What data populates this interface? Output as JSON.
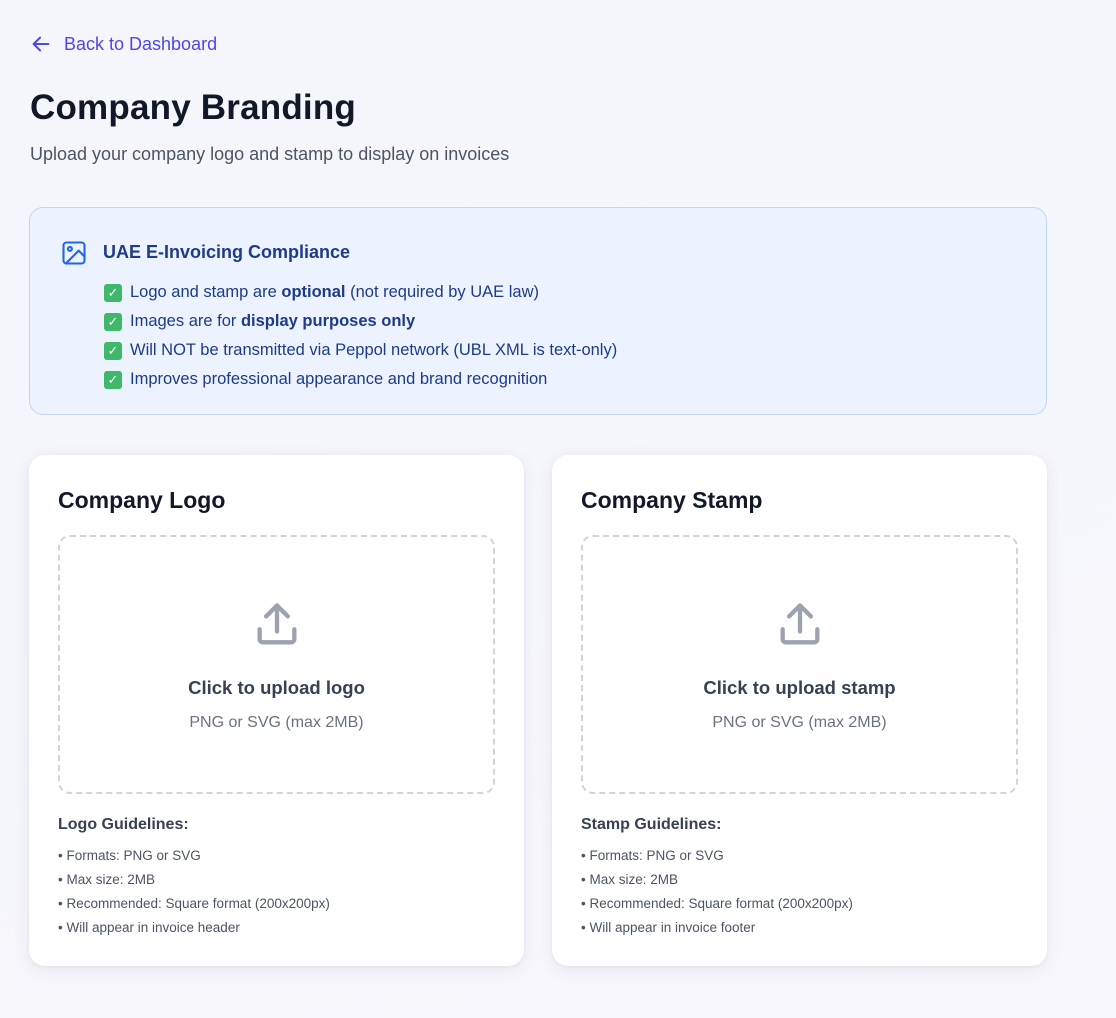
{
  "nav": {
    "back_label": "Back to Dashboard"
  },
  "header": {
    "title": "Company Branding",
    "subtitle": "Upload your company logo and stamp to display on invoices"
  },
  "notice": {
    "title": "UAE E-Invoicing Compliance",
    "items": [
      {
        "pre": "Logo and stamp are ",
        "bold": "optional",
        "post": " (not required by UAE law)"
      },
      {
        "pre": "Images are for ",
        "bold": "display purposes only",
        "post": ""
      },
      {
        "pre": "Will NOT be transmitted via Peppol network (UBL XML is text-only)",
        "bold": "",
        "post": ""
      },
      {
        "pre": "Improves professional appearance and brand recognition",
        "bold": "",
        "post": ""
      }
    ]
  },
  "logo_card": {
    "title": "Company Logo",
    "upload_label": "Click to upload logo",
    "upload_hint": "PNG or SVG (max 2MB)",
    "guidelines_title": "Logo Guidelines:",
    "guidelines": [
      "• Formats: PNG or SVG",
      "• Max size: 2MB",
      "• Recommended: Square format (200x200px)",
      "• Will appear in invoice header"
    ]
  },
  "stamp_card": {
    "title": "Company Stamp",
    "upload_label": "Click to upload stamp",
    "upload_hint": "PNG or SVG (max 2MB)",
    "guidelines_title": "Stamp Guidelines:",
    "guidelines": [
      "• Formats: PNG or SVG",
      "• Max size: 2MB",
      "• Recommended: Square format (200x200px)",
      "• Will appear in invoice footer"
    ]
  },
  "icons": {
    "back": "arrow-left-icon",
    "notice": "image-icon",
    "check": "check-mark-icon",
    "upload": "upload-icon"
  },
  "colors": {
    "accent": "#4f46e5",
    "notice_bg": "#ecf3fe",
    "notice_border": "#bfd7f6",
    "notice_text": "#1e3a8a",
    "check_green": "#3fb869"
  }
}
